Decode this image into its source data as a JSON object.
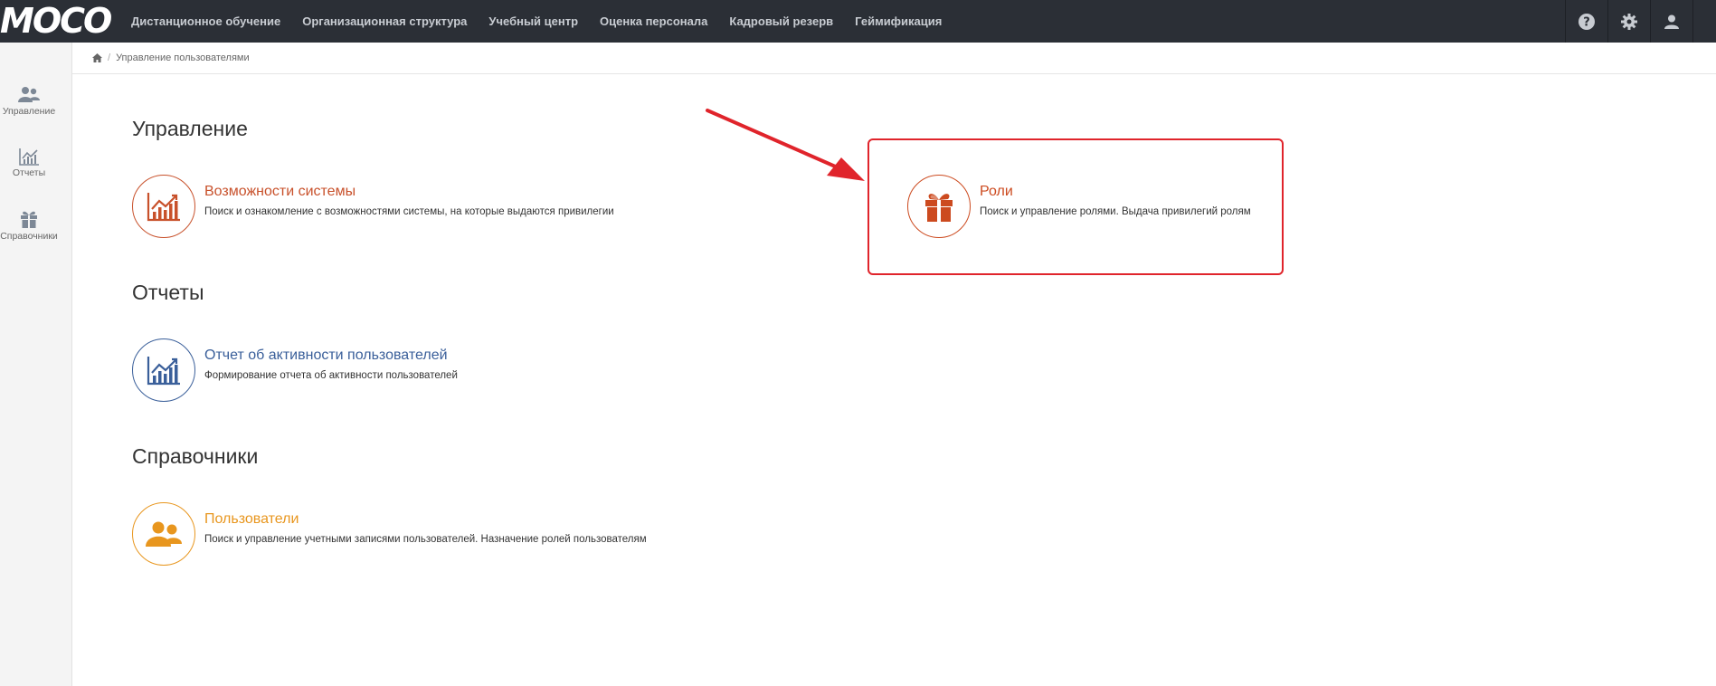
{
  "header": {
    "logo": "MOCO",
    "nav": [
      "Дистанционное обучение",
      "Организационная структура",
      "Учебный центр",
      "Оценка персонала",
      "Кадровый резерв",
      "Геймификация"
    ],
    "icons": [
      "help-icon",
      "gear-icon",
      "user-icon"
    ]
  },
  "sidebar": {
    "items": [
      {
        "label": "Управление",
        "icon": "users-icon"
      },
      {
        "label": "Отчеты",
        "icon": "chart-icon"
      },
      {
        "label": "Справочники",
        "icon": "gift-icon"
      }
    ]
  },
  "breadcrumb": {
    "home_icon": "home-icon",
    "current": "Управление пользователями"
  },
  "sections": {
    "management": {
      "title": "Управление",
      "cards": [
        {
          "title": "Возможности системы",
          "desc": "Поиск и ознакомление с возможностями системы, на которые выдаются привилегии",
          "color": "#c8512b",
          "icon": "chart-icon"
        },
        {
          "title": "Роли",
          "desc": "Поиск и управление ролями. Выдача привилегий ролям",
          "color": "#cc4a1f",
          "icon": "gift-icon"
        }
      ]
    },
    "reports": {
      "title": "Отчеты",
      "cards": [
        {
          "title": "Отчет об активности пользователей",
          "desc": "Формирование отчета об активности пользователей",
          "color": "#3a5f9a",
          "icon": "chart-icon"
        }
      ]
    },
    "directories": {
      "title": "Справочники",
      "cards": [
        {
          "title": "Пользователи",
          "desc": "Поиск и управление учетными записями пользователей. Назначение ролей пользователям",
          "color": "#e8961e",
          "icon": "users-icon"
        }
      ]
    }
  },
  "annotation": {
    "highlight_color": "#e0242b"
  }
}
